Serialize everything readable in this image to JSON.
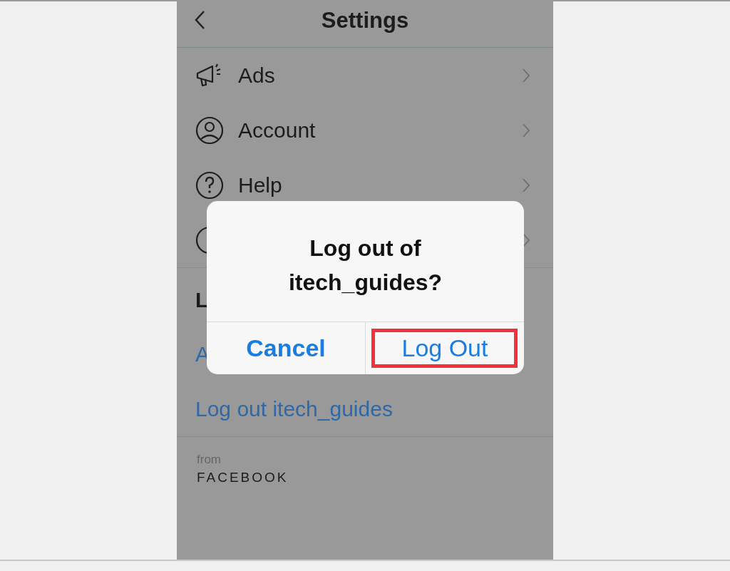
{
  "header": {
    "title": "Settings"
  },
  "menu_items": [
    {
      "label": "Ads",
      "kind": "megaphone"
    },
    {
      "label": "Account",
      "kind": "person"
    },
    {
      "label": "Help",
      "kind": "question"
    },
    {
      "kind": "circle"
    }
  ],
  "section_heading": "L",
  "links": [
    "A",
    "Log out itech_guides"
  ],
  "footer": {
    "from": "from",
    "brand": "FACEBOOK"
  },
  "dialog": {
    "title": "Log out of itech_guides?",
    "buttons": [
      {
        "label": "Cancel",
        "kind": "bold",
        "highlighted": false
      },
      {
        "label": "Log Out",
        "kind": "regular",
        "highlighted": true
      }
    ]
  }
}
